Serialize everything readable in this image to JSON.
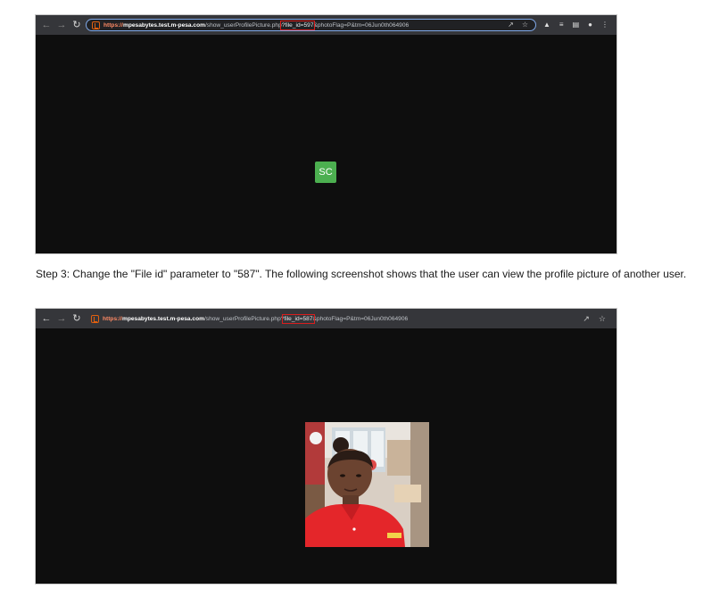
{
  "screenshot1": {
    "url": {
      "protocol": "https://",
      "host": "mpesabytes.test.m-pesa.com",
      "path": "/show_userProfilePicture.php",
      "highlight": "?file_id=597",
      "rest": "&photoFlag=P&tm=06Jun0th064906"
    },
    "avatar_initials": "SC",
    "avatar_color": "#4caf50"
  },
  "caption": "Step 3: Change the \"File id\" parameter to \"587\". The following screenshot shows that the user can view the profile picture of another user.",
  "screenshot2": {
    "url": {
      "protocol": "https://",
      "host": "mpesabytes.test.m-pesa.com",
      "path": "/show_userProfilePicture.php",
      "sep": "?",
      "highlight": "file_id=587",
      "rest": "&photoFlag=P&tm=06Jun0th064906"
    }
  },
  "icons": {
    "back": "arrow-left",
    "forward": "arrow-right",
    "reload": "reload",
    "share": "share",
    "bookmark": "star",
    "labs": "flask",
    "reading_list": "list",
    "side_panel": "panel",
    "profile": "person",
    "menu": "kebab"
  }
}
